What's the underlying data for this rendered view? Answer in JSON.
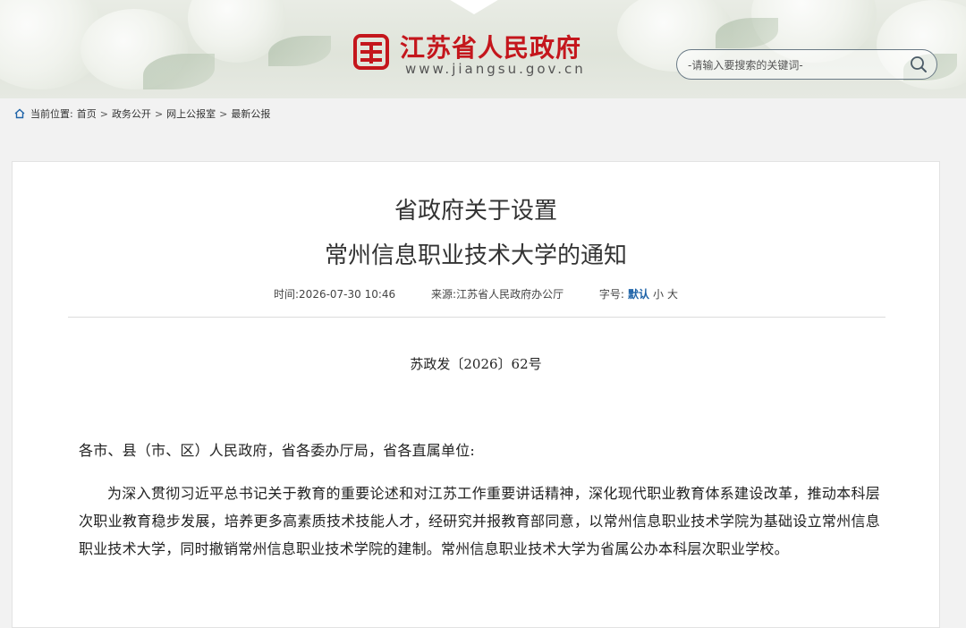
{
  "header": {
    "site_title": "江苏省人民政府",
    "site_url": "www.jiangsu.gov.cn",
    "search_placeholder": "-请输入要搜索的关键词-"
  },
  "breadcrumb": {
    "label": "当前位置:",
    "items": [
      "首页",
      "政务公开",
      "网上公报室",
      "最新公报"
    ],
    "separator": ">"
  },
  "article": {
    "title_line1": "省政府关于设置",
    "title_line2": "常州信息职业技术大学的通知",
    "meta": {
      "time_label": "时间:",
      "time_value": "2026-07-30 10:46",
      "source_label": "来源:",
      "source_value": "江苏省人民政府办公厅",
      "font_label": "字号:",
      "font_default": "默认",
      "font_small": "小",
      "font_large": "大"
    },
    "doc_number": "苏政发〔2026〕62号",
    "salutation": "各市、县（市、区）人民政府，省各委办厅局，省各直属单位:",
    "paragraph1": "为深入贯彻习近平总书记关于教育的重要论述和对江苏工作重要讲话精神，深化现代职业教育体系建设改革，推动本科层次职业教育稳步发展，培养更多高素质技术技能人才，经研究并报教育部同意，以常州信息职业技术学院为基础设立常州信息职业技术大学，同时撤销常州信息职业技术学院的建制。常州信息职业技术大学为省属公办本科层次职业学校。"
  },
  "colors": {
    "brand_red": "#c4161c",
    "active_font_blue": "#1e63a8",
    "page_bg": "#f2f2f2"
  },
  "icons": {
    "logo": "jiangsu-seal-icon",
    "search": "search-icon",
    "home": "home-icon"
  }
}
